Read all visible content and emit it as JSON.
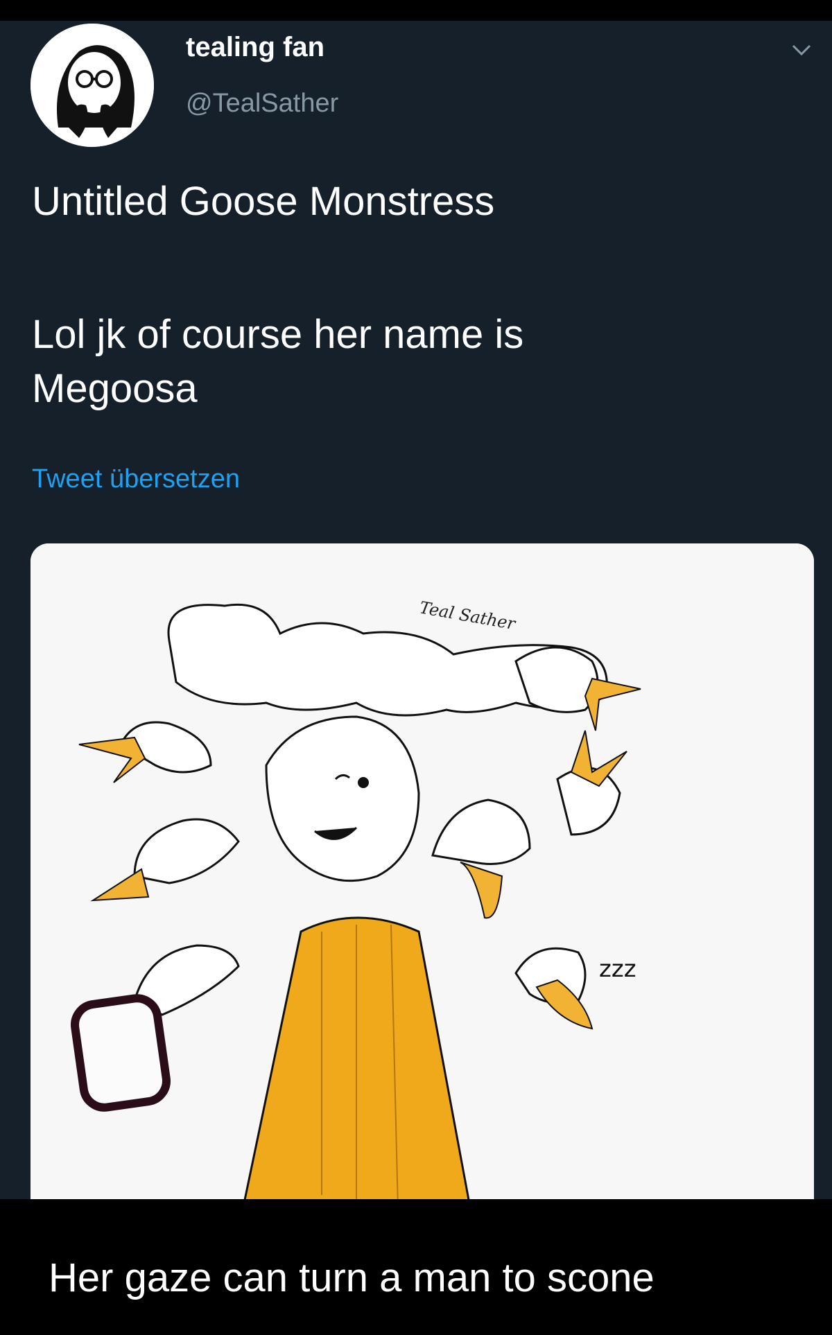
{
  "tweet": {
    "display_name": "tealing fan",
    "handle": "@TealSather",
    "text_line1": "Untitled Goose Monstress",
    "text_line2": "Lol jk of course her name is Megoosa",
    "translate_label": "Tweet übersetzen",
    "icons": {
      "menu": "chevron-down-icon",
      "avatar": "avatar"
    },
    "media": {
      "signature": "Teal Sather",
      "sleep_text": "zzz"
    }
  },
  "caption": "Her gaze can turn a man to scone",
  "colors": {
    "background": "#15202b",
    "text": "#ffffff",
    "secondary_text": "#8899a6",
    "link": "#1da1f2",
    "beak": "#f2b233",
    "dress": "#f0a91a"
  }
}
